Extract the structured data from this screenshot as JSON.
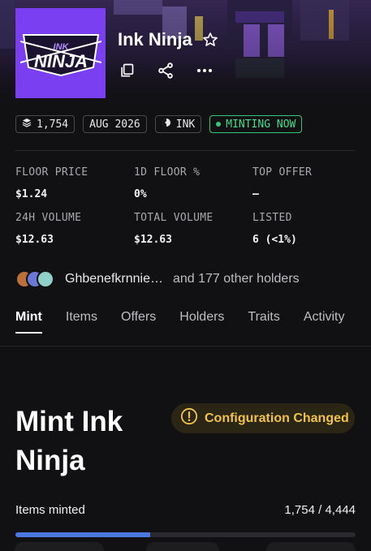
{
  "collection": {
    "title": "Ink Ninja",
    "logo_text_top": "INK",
    "logo_text_main": "NINJA"
  },
  "chips": {
    "supply": "1,754",
    "date": "AUG 2026",
    "chain": "INK",
    "status": "MINTING NOW"
  },
  "stats": [
    {
      "label": "FLOOR PRICE",
      "value": "$1.24"
    },
    {
      "label": "1D FLOOR %",
      "value": "0%"
    },
    {
      "label": "TOP OFFER",
      "value": "–"
    },
    {
      "label": "24H VOLUME",
      "value": "$12.63"
    },
    {
      "label": "TOTAL VOLUME",
      "value": "$12.63"
    },
    {
      "label": "LISTED",
      "value": "6 (<1%)"
    }
  ],
  "holders": {
    "name": "Ghbenefkrnnie…",
    "others": "and 177 other holders"
  },
  "tabs": [
    "Mint",
    "Items",
    "Offers",
    "Holders",
    "Traits",
    "Activity"
  ],
  "mint": {
    "title": "Mint Ink Ninja",
    "config_badge": "Configuration Changed",
    "items_minted_label": "Items minted",
    "items_minted_value": "1,754 / 4,444",
    "progress": 0.395
  },
  "colors": {
    "accent_purple": "#7b3ff2",
    "mint_green": "#34c97a",
    "warning_gold": "#f0c24b",
    "progress_blue": "#4a78e0"
  },
  "icons": [
    "star-icon",
    "copy-icon",
    "share-icon",
    "more-icon",
    "layers-icon",
    "ink-chain-icon",
    "warning-icon"
  ]
}
